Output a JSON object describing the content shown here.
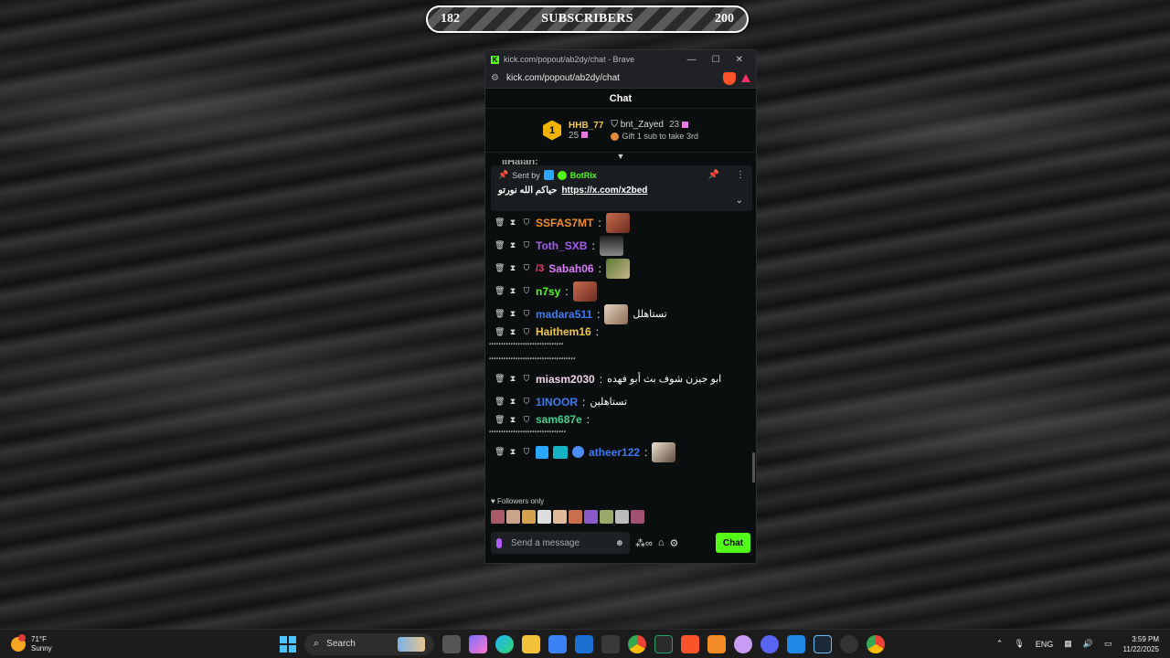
{
  "banner": {
    "left": "182",
    "title": "SUBSCRIBERS",
    "right": "200"
  },
  "window": {
    "title": "kick.com/popout/ab2dy/chat - Brave",
    "url": "kick.com/popout/ab2dy/chat"
  },
  "chat": {
    "header": "Chat",
    "leaderboard": {
      "first": {
        "rank": "1",
        "name": "HHB_77",
        "count": "25"
      },
      "second": {
        "name": "bnt_Zayed",
        "count": "23",
        "gift_text": "Gift 1 sub to take 3rd"
      }
    },
    "cut_row": "IIHaiah:",
    "pinned": {
      "sent_by": "Sent by",
      "bot": "BotRix",
      "text": "حياكم الله نورتو",
      "link": "https://x.com/x2bed"
    },
    "messages": [
      {
        "user": "SSFAS7MT",
        "color": "#f28c28",
        "text": ""
      },
      {
        "user": "Toth_SXB",
        "color": "#a45cf0",
        "text": ""
      },
      {
        "user": "Sabah06",
        "color": "#d97cf7",
        "text": ""
      },
      {
        "user": "n7sy",
        "color": "#53fc18",
        "text": ""
      },
      {
        "user": "madara511",
        "color": "#3b7bf2",
        "text": "تستاهلل"
      },
      {
        "user": "Haithem16",
        "color": "#f2c744",
        "text": "",
        "long1": "ٴٴٴٴٴٴٴٴٴٴٴٴٴٴٴٴٴٴٴٴٴٴٴٴٴٴٴٴٴٴٴ",
        "long2": "ٴٴٴٴٴٴٴٴٴٴٴٴٴٴٴٴٴٴٴٴٴٴٴٴٴٴٴٴٴٴٴٴٴٴٴٴ"
      },
      {
        "user": "miasm2030",
        "color": "#f0d3e9",
        "text": "ابو جيزن شوف بث أبو فهده"
      },
      {
        "user": "1INOOR",
        "color": "#3b7bf2",
        "text": "تستاهلين"
      },
      {
        "user": "sam687e",
        "color": "#3fcf8e",
        "text": "",
        "long1": "ٴٴٴٴٴٴٴٴٴٴٴٴٴٴٴٴٴٴٴٴٴٴٴٴٴٴٴٴٴٴٴٴ"
      },
      {
        "user": "atheer122",
        "color": "#3b7bf2",
        "text": ""
      }
    ],
    "followers_only": "Followers only",
    "input_placeholder": "Send a message",
    "chat_button": "Chat"
  },
  "taskbar": {
    "temp": "71°F",
    "condition": "Sunny",
    "search_placeholder": "Search",
    "language": "ENG",
    "time": "3:59 PM",
    "date": "11/22/2025"
  }
}
